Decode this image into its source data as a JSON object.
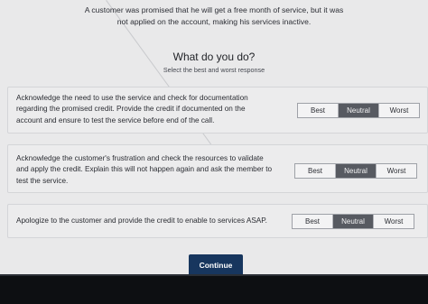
{
  "scenario": {
    "line1": "A customer was promised that he will get a free month of service, but it was",
    "line2": "not applied on the account, making his services inactive."
  },
  "question": "What do you do?",
  "instruction": "Select the best and worst response",
  "options": [
    {
      "lines": [
        "Acknowledge the need to use the service and check for documentation",
        "regarding the promised credit. Provide the credit if documented on the",
        "account and ensure to test the service before end of the call."
      ],
      "choices": [
        "Best",
        "Neutral",
        "Worst"
      ],
      "selected": "Neutral"
    },
    {
      "lines": [
        "Acknowledge the customer's frustration and check the resources to validate",
        "and apply the credit. Explain this will not happen again and ask the member to",
        "test the service."
      ],
      "choices": [
        "Best",
        "Neutral",
        "Worst"
      ],
      "selected": "Neutral"
    },
    {
      "lines": [
        "Apologize to the customer and provide the credit to enable to services ASAP."
      ],
      "choices": [
        "Best",
        "Neutral",
        "Worst"
      ],
      "selected": "Neutral"
    }
  ],
  "continue_label": "Continue",
  "colors": {
    "background": "#e9e9ea",
    "selected_choice": "#575a61",
    "continue_button": "#17365e",
    "taskbar": "#0d0f12"
  }
}
